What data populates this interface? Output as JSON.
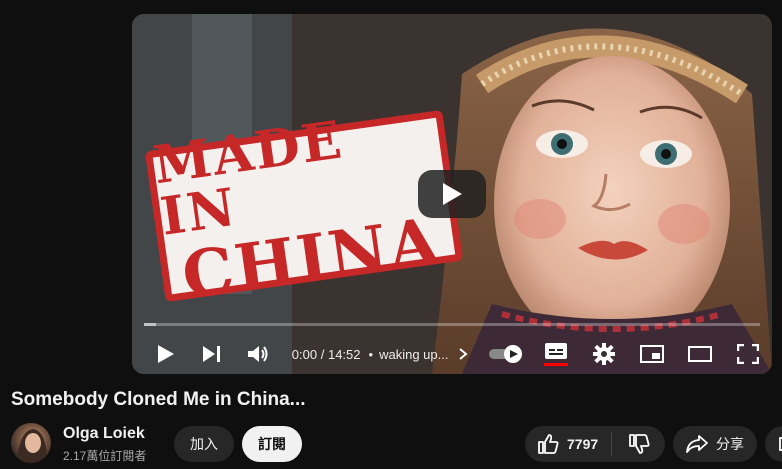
{
  "player": {
    "thumbnail_text": [
      "MADE IN",
      "CHINA"
    ],
    "time_current": "0:00",
    "time_separator": "/",
    "time_total": "14:52",
    "chapter": "waking up...",
    "progress_fraction": 0.02,
    "accent_color": "#ff0000",
    "controls": {
      "play_icon": "play-icon",
      "next_icon": "next-icon",
      "volume_icon": "volume-icon",
      "autoplay_icon": "autoplay-toggle-icon",
      "captions_icon": "captions-icon",
      "settings_icon": "gear-icon",
      "miniplayer_icon": "miniplayer-icon",
      "theater_icon": "theater-icon",
      "fullscreen_icon": "fullscreen-icon"
    }
  },
  "video": {
    "title": "Somebody Cloned Me in China..."
  },
  "channel": {
    "name": "Olga Loiek",
    "subscribers": "2.17萬位訂閱者",
    "join_label": "加入",
    "subscribe_label": "訂閱"
  },
  "actions": {
    "like_count": "7797",
    "share_label": "分享"
  }
}
